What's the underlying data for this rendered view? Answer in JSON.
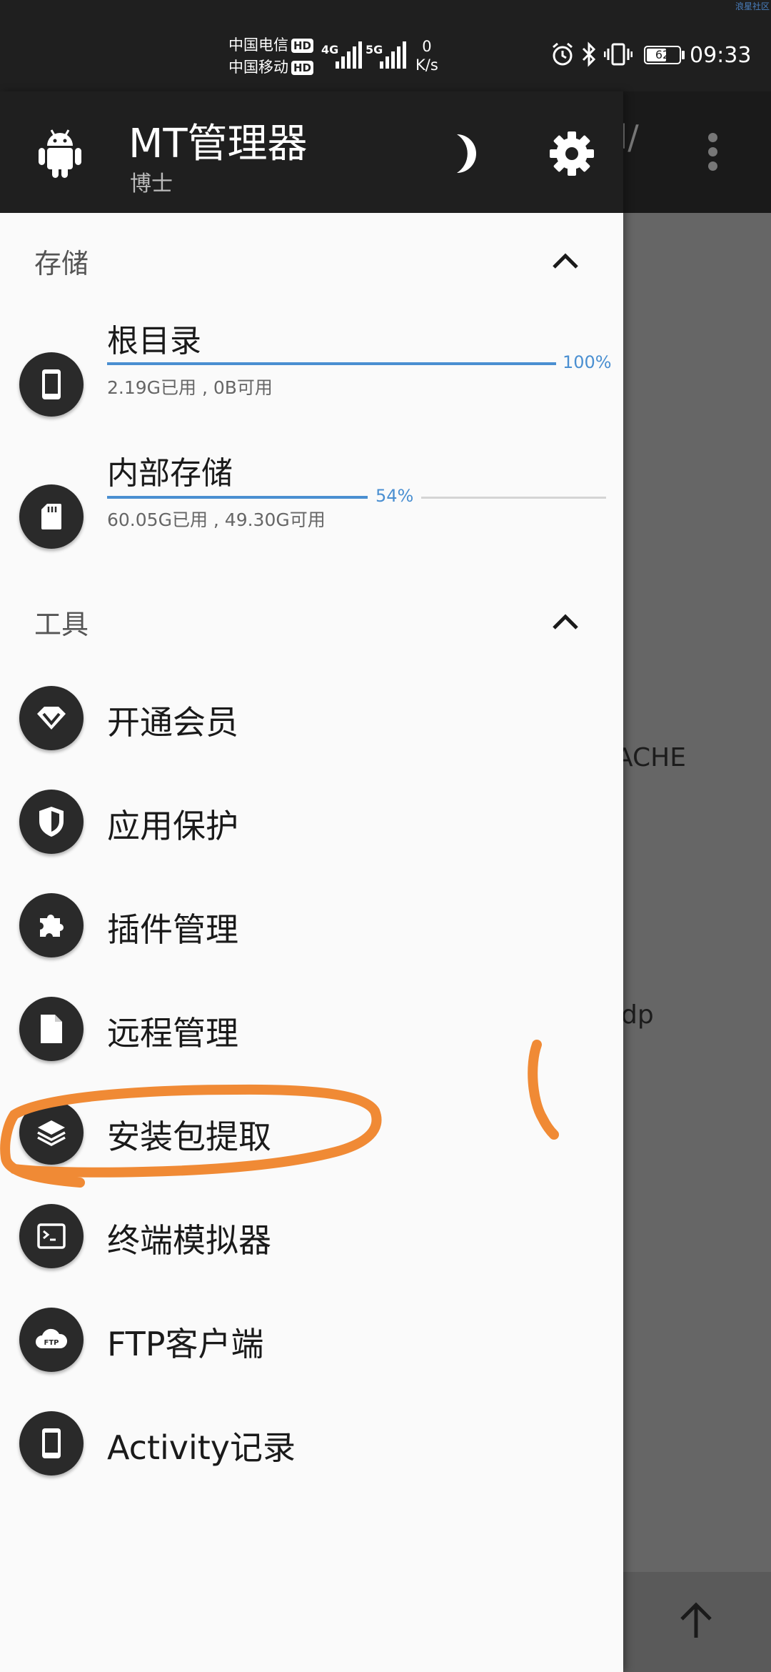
{
  "status_bar": {
    "carrier1": "中国电信",
    "carrier2": "中国移动",
    "hd": "HD",
    "net1": "4G",
    "net2": "5G",
    "speed_value": "0",
    "speed_unit": "K/s",
    "battery": "62",
    "battery_level": 0.62,
    "time": "09:33",
    "watermark": "浪星社区"
  },
  "background": {
    "path_fragment": "d/",
    "text1": "ACHE",
    "text2": "dp"
  },
  "drawer": {
    "app_title": "MT管理器",
    "user_name": "博士",
    "storage_section": "存储",
    "storage": [
      {
        "name": "根目录",
        "percent": "100%",
        "used_fraction": 1.0,
        "info": "2.19G已用 , 0B可用"
      },
      {
        "name": "内部存储",
        "percent": "54%",
        "used_fraction": 0.54,
        "info": "60.05G已用 , 49.30G可用"
      }
    ],
    "tools_section": "工具",
    "tools": [
      {
        "label": "开通会员",
        "icon": "diamond-icon"
      },
      {
        "label": "应用保护",
        "icon": "shield-icon"
      },
      {
        "label": "插件管理",
        "icon": "puzzle-icon"
      },
      {
        "label": "远程管理",
        "icon": "file-icon"
      },
      {
        "label": "安装包提取",
        "icon": "layers-icon"
      },
      {
        "label": "终端模拟器",
        "icon": "terminal-icon"
      },
      {
        "label": "FTP客户端",
        "icon": "ftp-cloud-icon"
      },
      {
        "label": "Activity记录",
        "icon": "phone-icon"
      }
    ]
  },
  "icons": {
    "ftp_text": "FTP"
  },
  "colors": {
    "accent": "#4a8fd1",
    "annotation": "#f08a35",
    "header": "#1f1f1f"
  }
}
